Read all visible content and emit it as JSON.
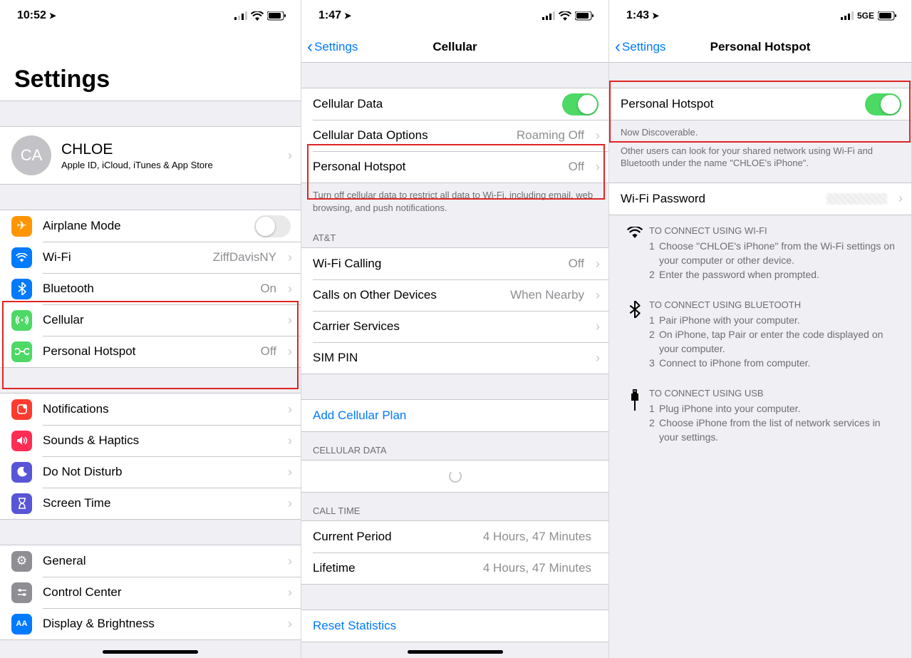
{
  "pane1": {
    "status": {
      "time": "10:52"
    },
    "title": "Settings",
    "profile": {
      "initials": "CA",
      "name": "CHLOE",
      "sub": "Apple ID, iCloud, iTunes & App Store"
    },
    "group1": {
      "airplane": "Airplane Mode",
      "wifi": "Wi-Fi",
      "wifi_val": "ZiffDavisNY",
      "bt": "Bluetooth",
      "bt_val": "On",
      "cellular": "Cellular",
      "hotspot": "Personal Hotspot",
      "hotspot_val": "Off"
    },
    "group2": {
      "notifications": "Notifications",
      "sounds": "Sounds & Haptics",
      "dnd": "Do Not Disturb",
      "screentime": "Screen Time"
    },
    "group3": {
      "general": "General",
      "control": "Control Center",
      "display": "Display & Brightness"
    }
  },
  "pane2": {
    "status": {
      "time": "1:47"
    },
    "back": "Settings",
    "title": "Cellular",
    "group1": {
      "cell_data": "Cellular Data",
      "cell_opt": "Cellular Data Options",
      "cell_opt_val": "Roaming Off",
      "hotspot": "Personal Hotspot",
      "hotspot_val": "Off"
    },
    "foot1": "Turn off cellular data to restrict all data to Wi-Fi, including email, web browsing, and push notifications.",
    "head_att": "AT&T",
    "group2": {
      "wificall": "Wi-Fi Calling",
      "wificall_val": "Off",
      "calls_other": "Calls on Other Devices",
      "calls_other_val": "When Nearby",
      "carrier": "Carrier Services",
      "simpin": "SIM PIN"
    },
    "add_plan": "Add Cellular Plan",
    "head_cd": "CELLULAR DATA",
    "head_ct": "CALL TIME",
    "group_ct": {
      "current": "Current Period",
      "current_val": "4 Hours, 47 Minutes",
      "lifetime": "Lifetime",
      "lifetime_val": "4 Hours, 47 Minutes"
    },
    "reset": "Reset Statistics"
  },
  "pane3": {
    "status": {
      "time": "1:43",
      "net": "5GE"
    },
    "back": "Settings",
    "title": "Personal Hotspot",
    "row1": "Personal Hotspot",
    "foot1a": "Now Discoverable.",
    "foot1b": "Other users can look for your shared network using Wi-Fi and Bluetooth under the name \"CHLOE's iPhone\".",
    "wifi_pw": "Wi-Fi Password",
    "instr_wifi": {
      "head": "TO CONNECT USING WI-FI",
      "l1": "Choose \"CHLOE's iPhone\" from the Wi-Fi settings on your computer or other device.",
      "l2": "Enter the password when prompted."
    },
    "instr_bt": {
      "head": "TO CONNECT USING BLUETOOTH",
      "l1": "Pair iPhone with your computer.",
      "l2": "On iPhone, tap Pair or enter the code displayed on your computer.",
      "l3": "Connect to iPhone from computer."
    },
    "instr_usb": {
      "head": "TO CONNECT USING USB",
      "l1": "Plug iPhone into your computer.",
      "l2": "Choose iPhone from the list of network services in your settings."
    }
  }
}
